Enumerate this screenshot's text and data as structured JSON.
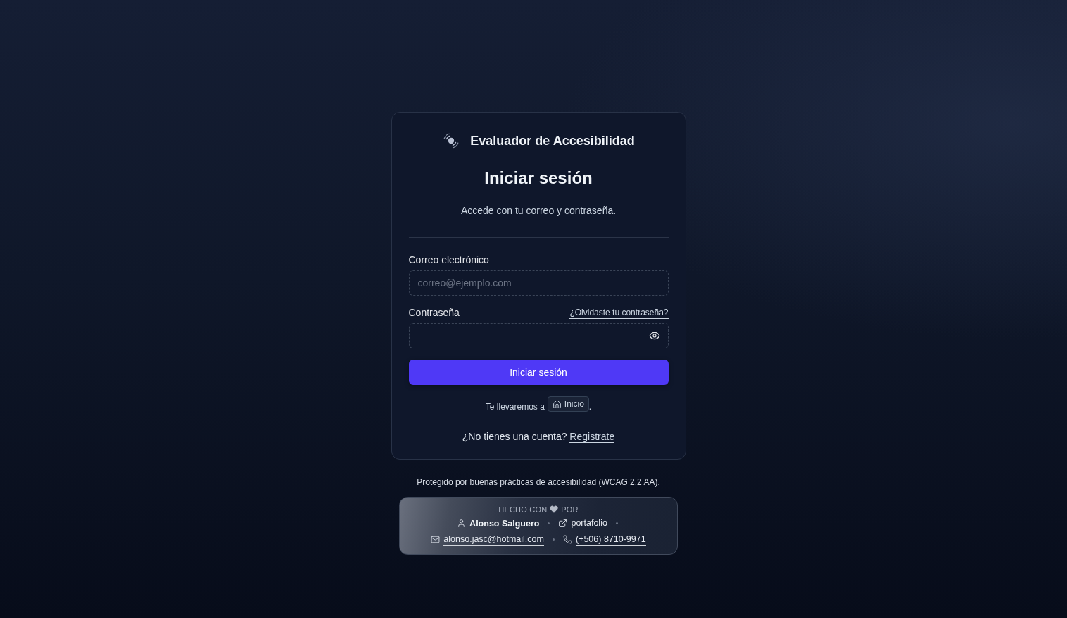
{
  "app": {
    "title": "Evaluador de Accesibilidad"
  },
  "login_card": {
    "heading": "Iniciar sesión",
    "subtitle": "Accede con tu correo y contraseña.",
    "fields": [
      {
        "kind": "email",
        "label": "Correo electrónico",
        "placeholder": "correo@ejemplo.com"
      },
      {
        "kind": "password",
        "label": "Contraseña",
        "link": "¿Olvidaste tu contraseña?"
      }
    ],
    "submit_button": "Iniciar sesión",
    "redirect_note": {
      "text": "Te llevaremos a",
      "destination": "Inicio",
      "end": "."
    },
    "register_prompt": {
      "text": "¿No tienes una cuenta?",
      "link": "Registrate"
    }
  },
  "footer": {
    "note": "Protegido por buenas prácticas de accesibilidad (WCAG 2.2 AA).",
    "credits": {
      "prefix": "HECHO CON",
      "suffix": "POR",
      "contacts": [
        {
          "kind": "person",
          "text": "Alonso Salguero"
        },
        {
          "kind": "website",
          "text": "portafolio"
        },
        {
          "kind": "email",
          "text": "alonso.jasc@hotmail.com"
        },
        {
          "kind": "phone",
          "text": "(+506) 8710-9971"
        }
      ]
    }
  }
}
